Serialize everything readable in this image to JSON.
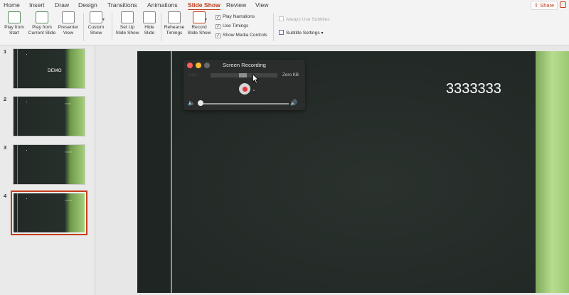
{
  "ribbon_tabs": [
    "Home",
    "Insert",
    "Draw",
    "Design",
    "Transitions",
    "Animations",
    "Slide Show",
    "Review",
    "View"
  ],
  "active_tab": "Slide Show",
  "share_label": "Share",
  "buttons": {
    "play_from_start": "Play from\nStart",
    "play_from_current": "Play from\nCurrent Slide",
    "presenter_view": "Presenter\nView",
    "custom_show": "Custom\nShow",
    "set_up": "Set Up\nSlide Show",
    "hide_slide": "Hide\nSlide",
    "rehearse": "Rehearse\nTimings",
    "record": "Record\nSlide Show"
  },
  "checks": {
    "play_narrations": "Play Narrations",
    "use_timings": "Use Timings",
    "show_media_controls": "Show Media Controls",
    "always_use_subtitles": "Always Use Subtitles",
    "subtitle_settings": "Subtitle Settings"
  },
  "thumbnails": [
    {
      "num": "1",
      "title": "DEMO"
    },
    {
      "num": "2",
      "title": ""
    },
    {
      "num": "3",
      "title": ""
    },
    {
      "num": "4",
      "title": ""
    }
  ],
  "slide_title": "3333333",
  "screen_recording": {
    "title": "Screen Recording",
    "time": "--:--",
    "size": "Zero KB",
    "volume": 0.0
  },
  "colors": {
    "accent": "#c43e1c",
    "slide_bg": "#232a27",
    "slide_green": "#a6cf7c",
    "record_red": "#e0353a"
  }
}
